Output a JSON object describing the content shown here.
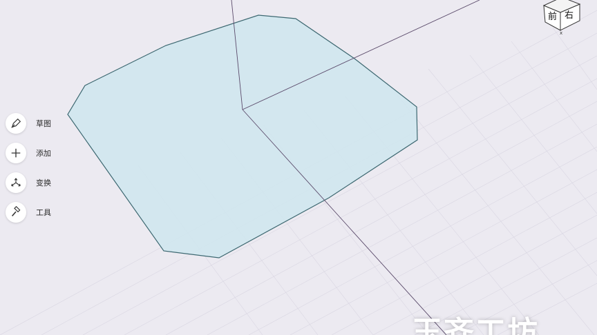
{
  "toolbar": {
    "items": [
      {
        "label": "草图",
        "icon": "pencil-icon"
      },
      {
        "label": "添加",
        "icon": "plus-icon"
      },
      {
        "label": "变换",
        "icon": "transform-arrows-icon"
      },
      {
        "label": "工具",
        "icon": "hammer-icon"
      }
    ]
  },
  "view_cube": {
    "front_label": "前",
    "right_label": "右",
    "axis_label": "x"
  },
  "watermark": {
    "text": "玉齐工坊"
  },
  "colors": {
    "background": "#eceaf1",
    "grid": "#d9d6e2",
    "shape_fill": "#cfe6ee",
    "shape_stroke": "#3c6770",
    "axis": "#5a4a6a"
  }
}
